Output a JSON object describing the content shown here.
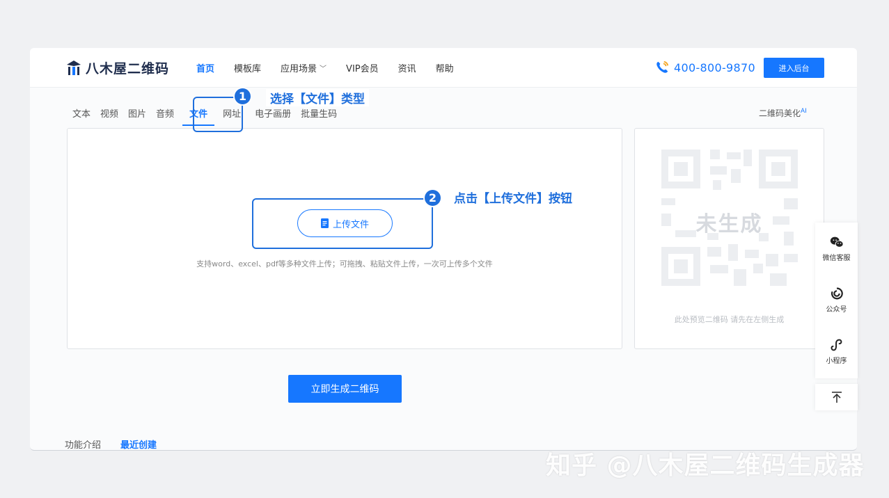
{
  "header": {
    "logo_text": "八木屋二维码",
    "nav": [
      {
        "label": "首页",
        "active": true
      },
      {
        "label": "模板库"
      },
      {
        "label": "应用场景",
        "dropdown": true
      },
      {
        "label": "VIP会员"
      },
      {
        "label": "资讯"
      },
      {
        "label": "帮助"
      }
    ],
    "phone": "400-800-9870",
    "admin_label": "进入后台"
  },
  "tabs": [
    {
      "label": "文本"
    },
    {
      "label": "视频"
    },
    {
      "label": "图片"
    },
    {
      "label": "音频"
    },
    {
      "label": "文件",
      "active": true
    },
    {
      "label": "网址"
    },
    {
      "label": "电子画册"
    },
    {
      "label": "批量生码"
    }
  ],
  "beautify": {
    "label": "二维码美化",
    "tag": "AI"
  },
  "annotations": {
    "step1_num": "1",
    "step1_text": "选择【文件】类型",
    "step2_num": "2",
    "step2_text": "点击【上传文件】按钮"
  },
  "upload": {
    "button_label": "上传文件",
    "hint": "支持word、excel、pdf等多种文件上传；可拖拽、粘贴文件上传，一次可上传多个文件"
  },
  "qr": {
    "placeholder_label": "未生成",
    "hint": "此处预览二维码 请先在左侧生成"
  },
  "generate_label": "立即生成二维码",
  "bottom_tabs": [
    {
      "label": "功能介绍"
    },
    {
      "label": "最近创建",
      "active": true
    }
  ],
  "float_bar": {
    "wechat": "微信客服",
    "official": "公众号",
    "miniapp": "小程序"
  },
  "watermark": "知乎 @八木屋二维码生成器",
  "colors": {
    "accent": "#1677ff",
    "annotation": "#1f6fdc"
  }
}
